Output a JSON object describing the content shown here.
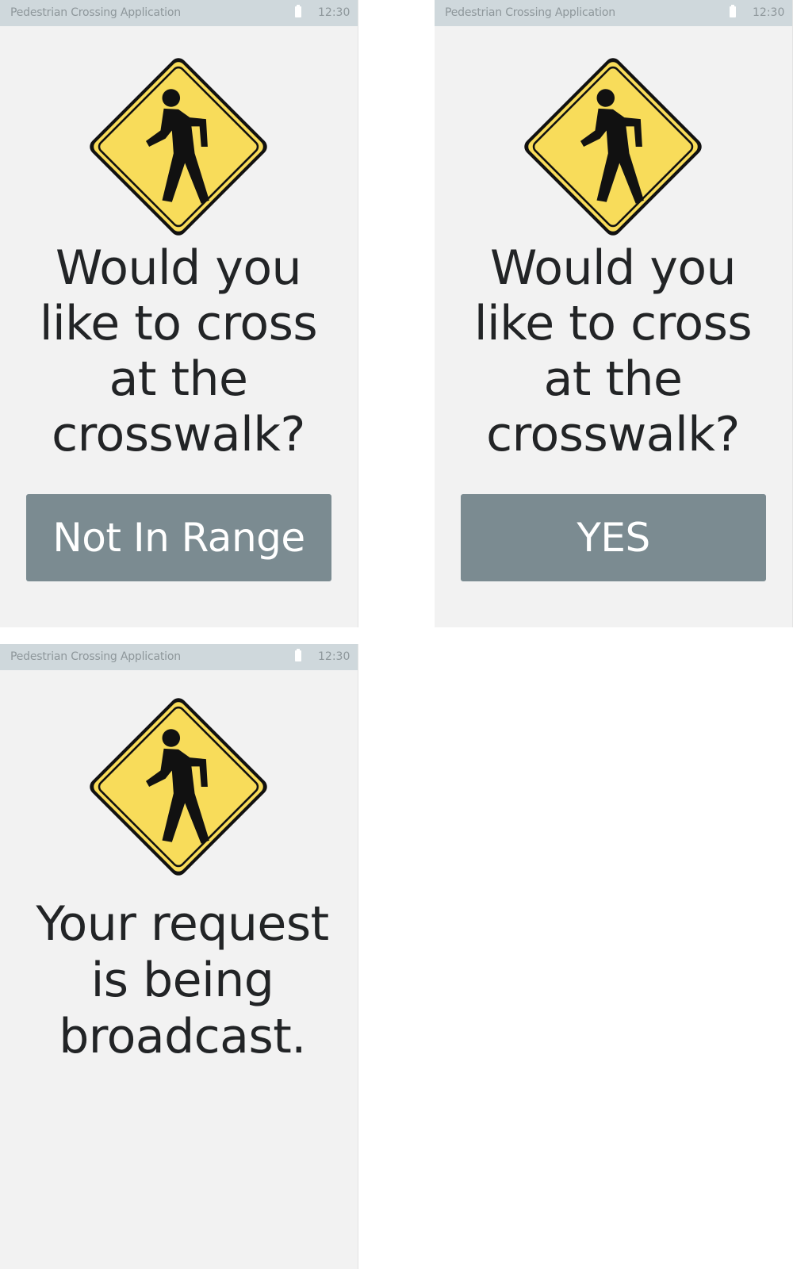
{
  "screens": [
    {
      "status_bar": {
        "title": "Pedestrian Crossing Application",
        "time": "12:30"
      },
      "sign_icon": "pedestrian-crossing-sign-icon",
      "question_lines": [
        "Would you",
        "like to cross",
        "at the",
        "crosswalk?"
      ],
      "button_label": "Not In Range"
    },
    {
      "status_bar": {
        "title": "Pedestrian Crossing Application",
        "time": "12:30"
      },
      "sign_icon": "pedestrian-crossing-sign-icon",
      "question_lines": [
        "Would you",
        "like to cross",
        "at the",
        "crosswalk?"
      ],
      "button_label": "YES"
    },
    {
      "status_bar": {
        "title": "Pedestrian Crossing Application",
        "time": "12:30"
      },
      "sign_icon": "pedestrian-crossing-sign-icon",
      "message_lines": [
        "Your request",
        "is being",
        "broadcast."
      ]
    }
  ],
  "colors": {
    "screen_background": "#f2f2f2",
    "status_bar": "#cfd8dc",
    "status_text": "#8e979b",
    "button": "#7b8b91",
    "button_text": "#ffffff",
    "sign_yellow": "#f8dc5a",
    "body_text": "#222426"
  }
}
